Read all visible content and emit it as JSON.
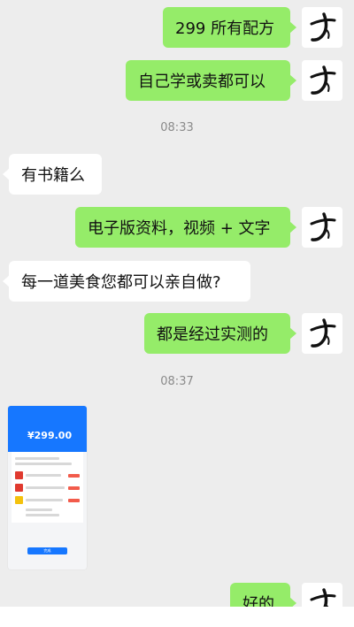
{
  "messages": [
    {
      "side": "right",
      "text": "299 所有配方"
    },
    {
      "side": "right",
      "text": "自己学或卖都可以"
    },
    {
      "side": "left",
      "text": "有书籍么"
    },
    {
      "side": "right",
      "text": "电子版资料，视频 + 文字"
    },
    {
      "side": "left",
      "text": "每一道美食您都可以亲自做?"
    },
    {
      "side": "right",
      "text": "都是经过实测的"
    },
    {
      "side": "right",
      "text": "好的"
    }
  ],
  "timestamps": [
    "08:33",
    "08:37"
  ],
  "payment_screenshot": {
    "amount": "¥299.00",
    "done_label": "完成"
  },
  "colors": {
    "background": "#ededed",
    "sent_bubble": "#95ec69",
    "received_bubble": "#ffffff",
    "payment_blue": "#1677ff"
  },
  "icons": {
    "avatar": "calligraphy-avatar-icon"
  }
}
